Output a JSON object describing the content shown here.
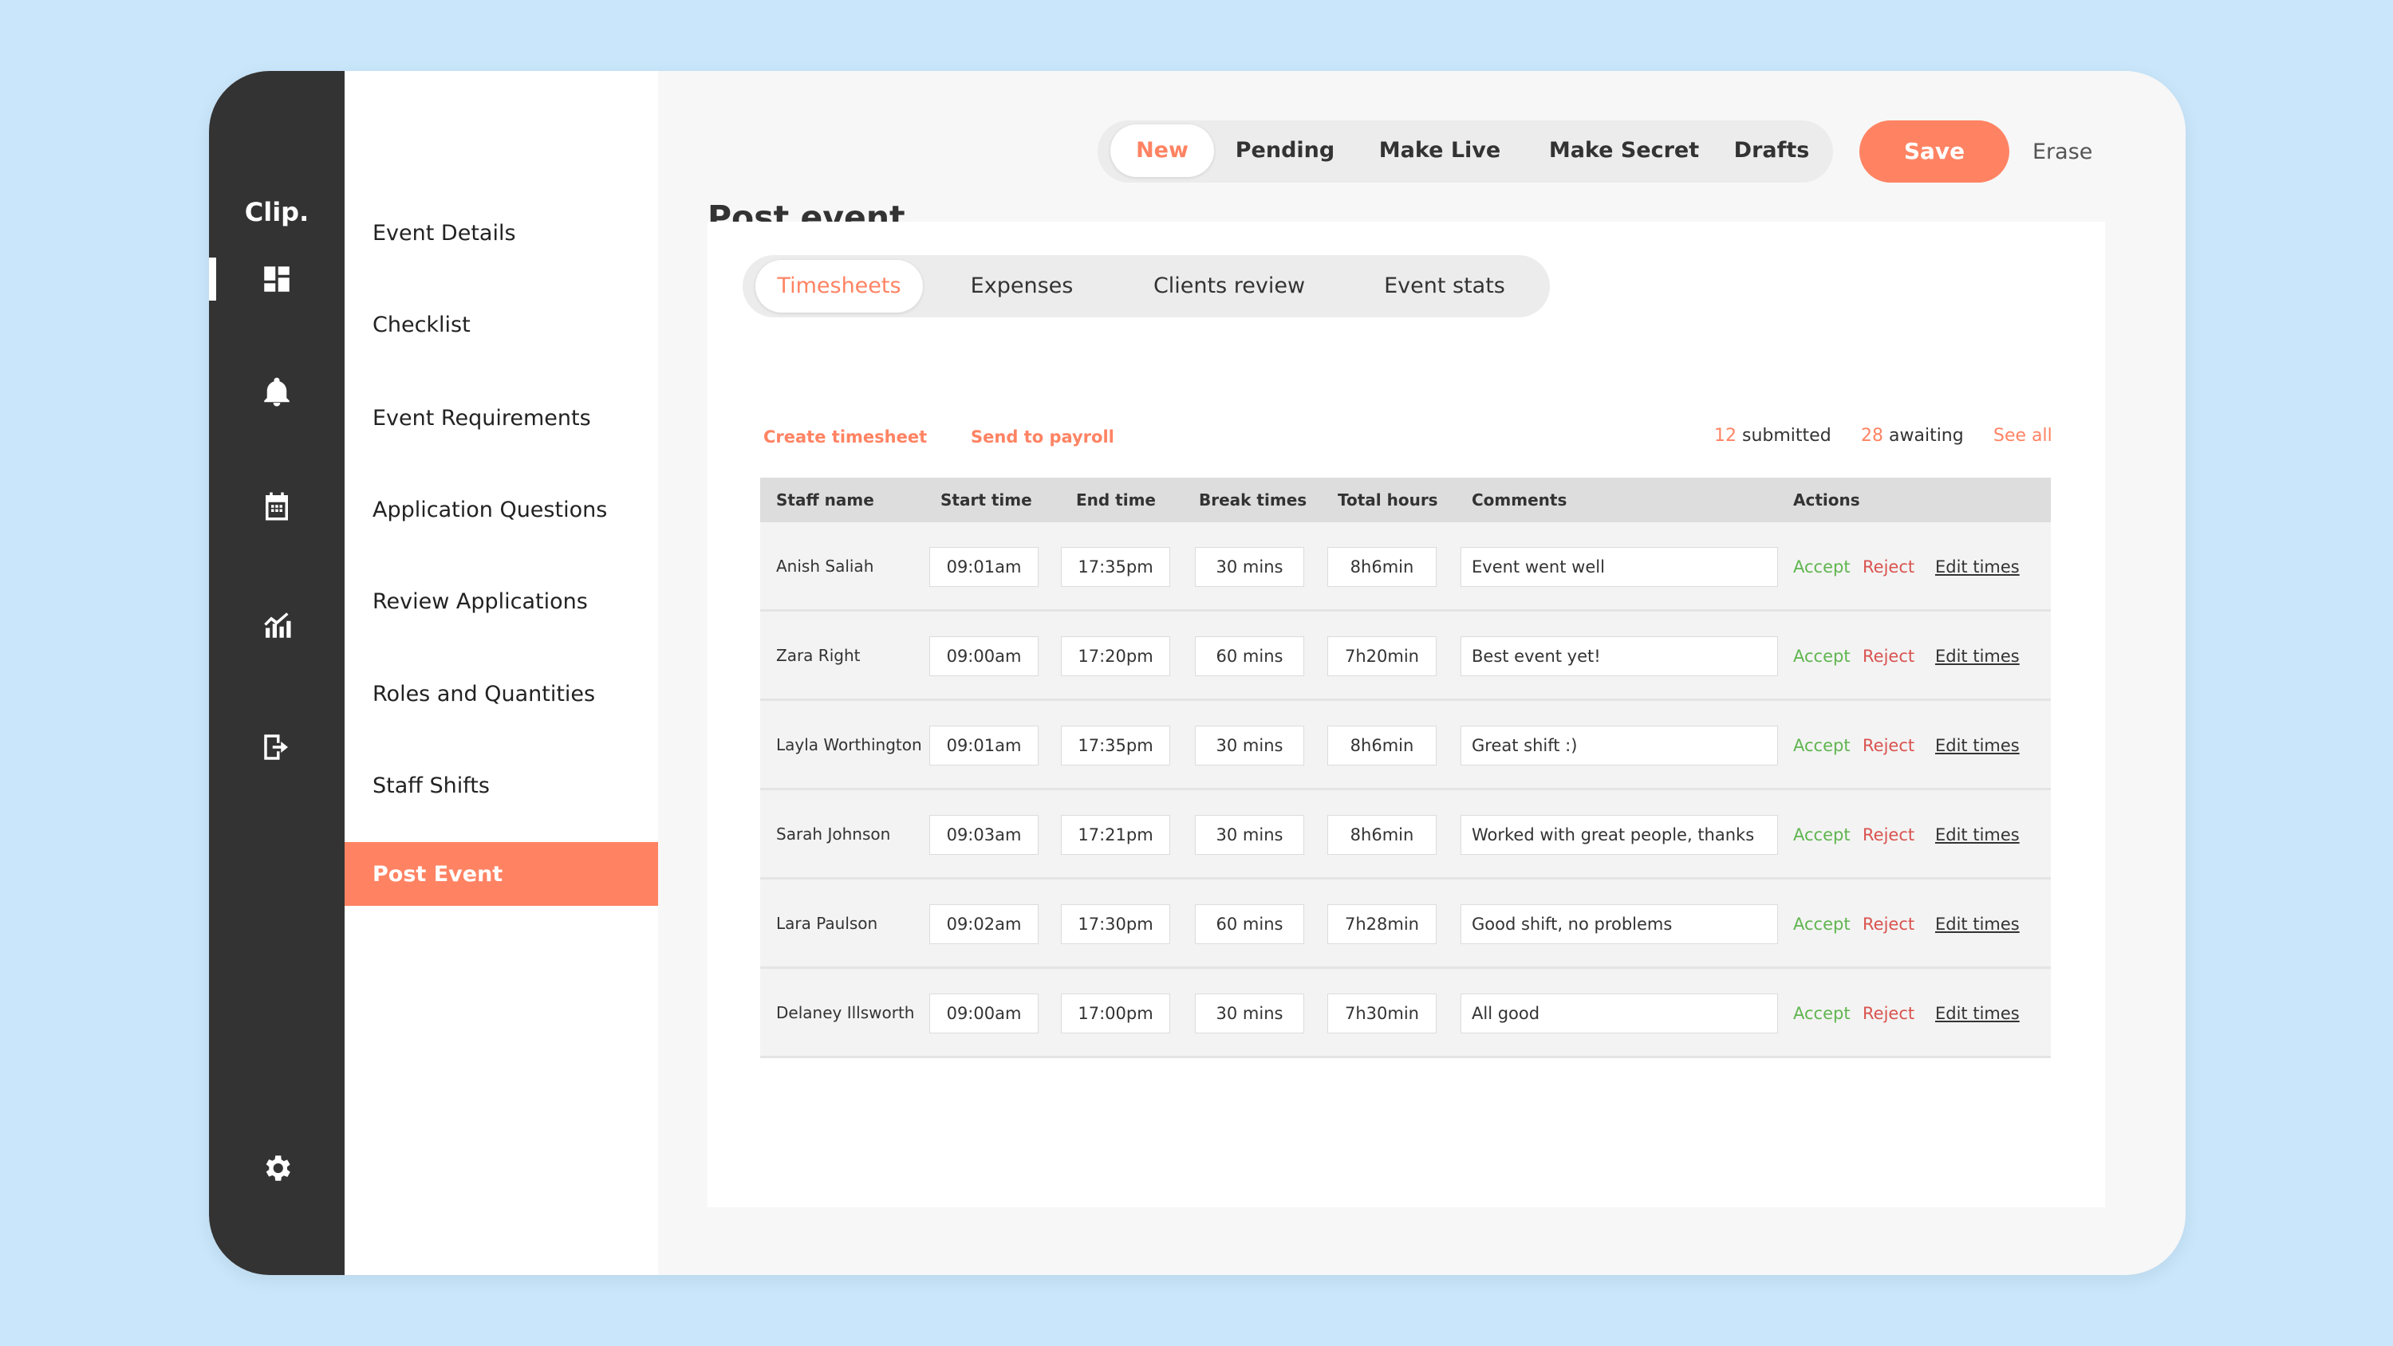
{
  "app": {
    "logo": "Clip."
  },
  "rail": {
    "icons": [
      "dashboard-icon",
      "bell-icon",
      "calendar-icon",
      "analytics-icon",
      "logout-icon",
      "gear-icon"
    ]
  },
  "nav": {
    "items": [
      {
        "label": "Event Details"
      },
      {
        "label": "Checklist"
      },
      {
        "label": "Event Requirements"
      },
      {
        "label": "Application Questions"
      },
      {
        "label": "Review Applications"
      },
      {
        "label": "Roles and Quantities"
      },
      {
        "label": "Staff Shifts"
      },
      {
        "label": "Post Event",
        "active": true
      }
    ]
  },
  "header": {
    "title": "Post event",
    "status_tabs": [
      {
        "label": "New",
        "active": true
      },
      {
        "label": "Pending"
      },
      {
        "label": "Make Live"
      },
      {
        "label": "Make Secret"
      },
      {
        "label": "Drafts"
      }
    ],
    "save_label": "Save",
    "erase_label": "Erase"
  },
  "card": {
    "tabs": [
      {
        "label": "Timesheets",
        "active": true
      },
      {
        "label": "Expenses"
      },
      {
        "label": "Clients review"
      },
      {
        "label": "Event stats"
      }
    ],
    "create_label": "Create timesheet",
    "payroll_label": "Send to payroll",
    "submitted_count": "12",
    "submitted_label": "submitted",
    "awaiting_count": "28",
    "awaiting_label": "awaiting",
    "see_all_label": "See all"
  },
  "table": {
    "columns": [
      "Staff name",
      "Start time",
      "End time",
      "Break times",
      "Total hours",
      "Comments",
      "Actions"
    ],
    "action_labels": {
      "accept": "Accept",
      "reject": "Reject",
      "edit": "Edit times"
    },
    "rows": [
      {
        "name": "Anish Saliah",
        "start": "09:01am",
        "end": "17:35pm",
        "break": "30 mins",
        "total": "8h6min",
        "comment": "Event went well"
      },
      {
        "name": "Zara Right",
        "start": "09:00am",
        "end": "17:20pm",
        "break": "60 mins",
        "total": "7h20min",
        "comment": "Best event yet!"
      },
      {
        "name": "Layla Worthington",
        "start": "09:01am",
        "end": "17:35pm",
        "break": "30 mins",
        "total": "8h6min",
        "comment": "Great shift :)"
      },
      {
        "name": "Sarah Johnson",
        "start": "09:03am",
        "end": "17:21pm",
        "break": "30 mins",
        "total": "8h6min",
        "comment": "Worked with great people, thanks"
      },
      {
        "name": "Lara Paulson",
        "start": "09:02am",
        "end": "17:30pm",
        "break": "60 mins",
        "total": "7h28min",
        "comment": "Good shift, no problems"
      },
      {
        "name": "Delaney Illsworth",
        "start": "09:00am",
        "end": "17:00pm",
        "break": "30 mins",
        "total": "7h30min",
        "comment": "All good"
      }
    ]
  },
  "colors": {
    "accent": "#ff8363",
    "rail": "#333333",
    "accept": "#5fb54f",
    "reject": "#d9534f",
    "background": "#c9e6fb"
  }
}
